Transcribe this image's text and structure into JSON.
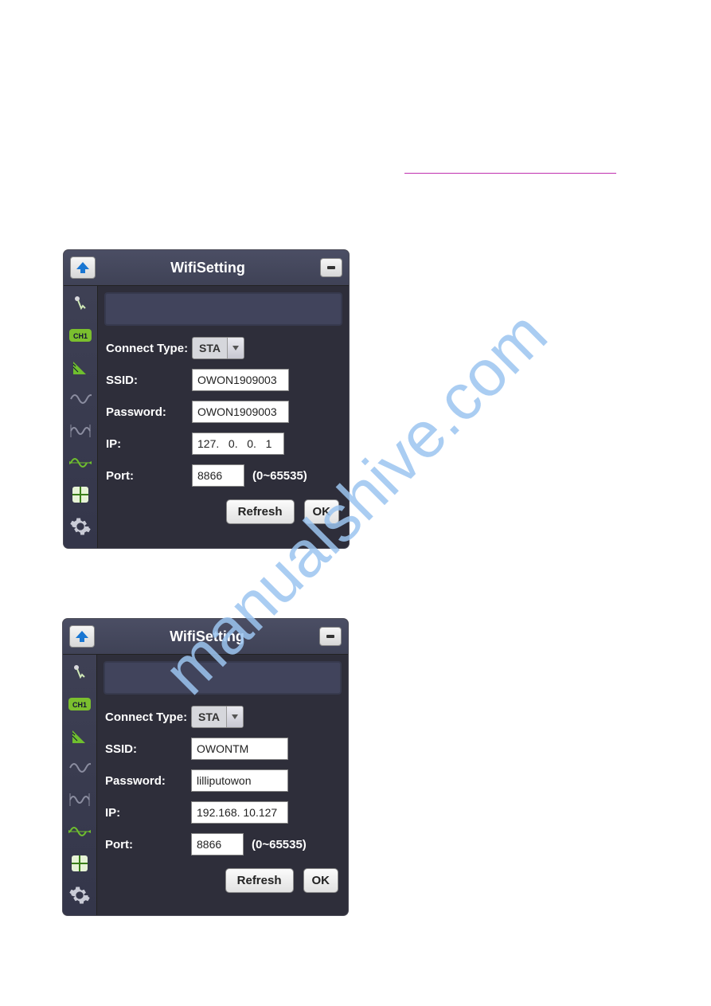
{
  "link_placeholder": "",
  "watermark": "manualshive.com",
  "panel1": {
    "title": "WifiSetting",
    "fields": {
      "connect_type_label": "Connect Type:",
      "connect_type_value": "STA",
      "ssid_label": "SSID:",
      "ssid_value": "OWON1909003",
      "password_label": "Password:",
      "password_value": "OWON1909003",
      "ip_label": "IP:",
      "ip_value": "127.   0.   0.   1",
      "port_label": "Port:",
      "port_value": "8866",
      "port_hint": "(0~65535)"
    },
    "buttons": {
      "refresh": "Refresh",
      "ok": "OK"
    }
  },
  "panel2": {
    "title": "WifiSetting",
    "fields": {
      "connect_type_label": "Connect Type:",
      "connect_type_value": "STA",
      "ssid_label": "SSID:",
      "ssid_value": "OWONTM",
      "password_label": "Password:",
      "password_value": "lilliputowon",
      "ip_label": "IP:",
      "ip_value": "192.168. 10.127",
      "port_label": "Port:",
      "port_value": "8866",
      "port_hint": "(0~65535)"
    },
    "buttons": {
      "refresh": "Refresh",
      "ok": "OK"
    }
  },
  "sidebar_icons": [
    "touch-icon",
    "ch1-icon",
    "ruler-icon",
    "wave1-icon",
    "wave2-icon",
    "wave3-icon",
    "crosshair-icon",
    "gear-icon"
  ]
}
